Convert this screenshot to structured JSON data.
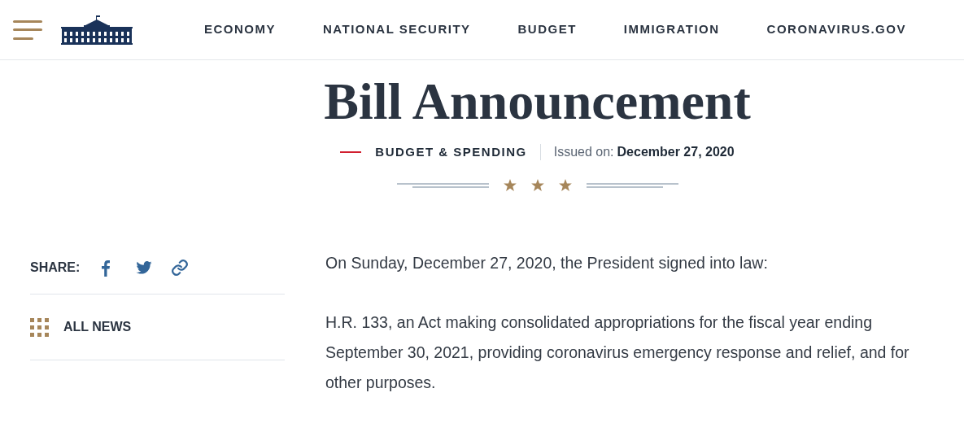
{
  "header": {
    "nav_items": [
      "ECONOMY",
      "NATIONAL SECURITY",
      "BUDGET",
      "IMMIGRATION",
      "CORONAVIRUS.GOV"
    ]
  },
  "article": {
    "title": "Bill Announcement",
    "category": "BUDGET & SPENDING",
    "issued_label": "Issued on:",
    "issued_date": "December 27, 2020",
    "paragraphs": [
      "On Sunday, December 27, 2020, the President signed into law:",
      "H.R. 133, an Act making consolidated appropriations for the fiscal year ending September 30, 2021, providing coronavirus emergency response and relief, and for other purposes."
    ]
  },
  "sidebar": {
    "share_label": "SHARE:",
    "all_news": "ALL NEWS"
  }
}
